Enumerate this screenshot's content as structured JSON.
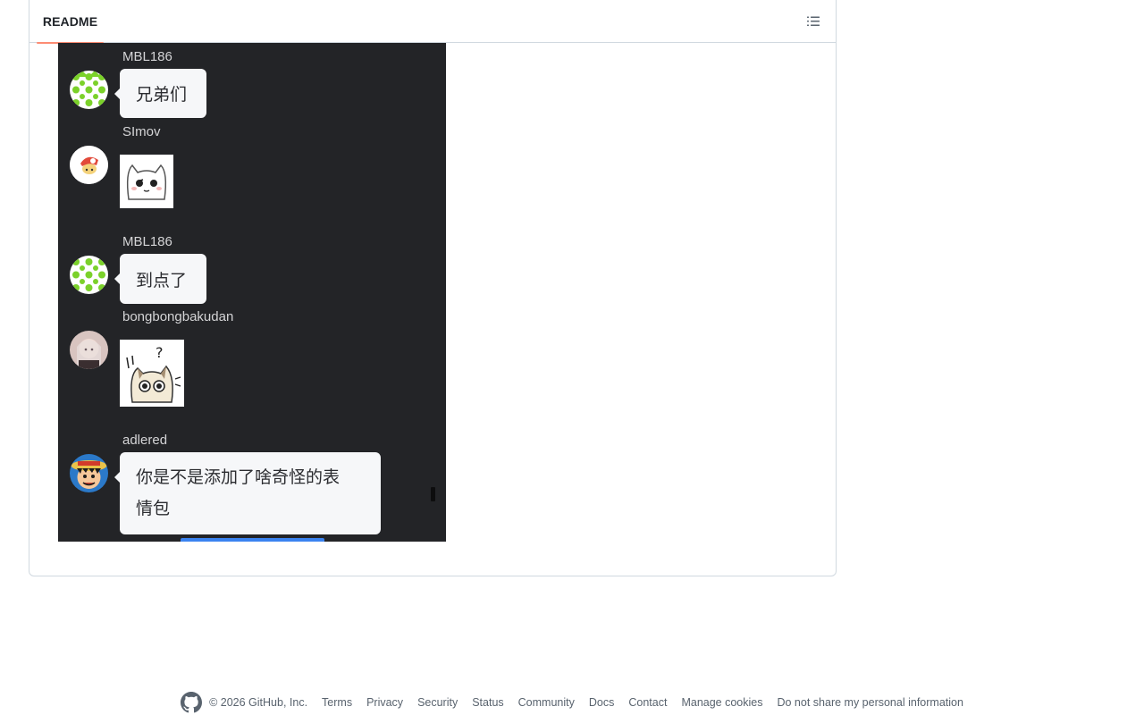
{
  "readme": {
    "tab_label": "README",
    "outline_icon": "list-unordered-icon"
  },
  "chat": {
    "messages": [
      {
        "name": "MBL186",
        "type": "text",
        "text": "兄弟们",
        "avatar": "green-pattern-avatar"
      },
      {
        "name": "SImov",
        "type": "sticker",
        "sticker": "white-cat-sticker",
        "avatar": "red-cap-character-avatar"
      },
      {
        "name": "MBL186",
        "type": "text",
        "text": "到点了",
        "avatar": "green-pattern-avatar"
      },
      {
        "name": "bongbongbakudan",
        "type": "sticker",
        "sticker": "confused-cat-sticker",
        "avatar": "anime-girl-avatar"
      },
      {
        "name": "adlered",
        "type": "text",
        "text_line1": "你是不是添加了啥奇怪的表",
        "text_line2": "情包",
        "avatar": "straw-hat-avatar"
      }
    ]
  },
  "footer": {
    "logo_icon": "github-mark-icon",
    "copyright": "© 2026 GitHub, Inc.",
    "links": [
      "Terms",
      "Privacy",
      "Security",
      "Status",
      "Community",
      "Docs",
      "Contact",
      "Manage cookies",
      "Do not share my personal information"
    ]
  },
  "colors": {
    "chat_background": "#232427",
    "bubble_background": "#f6f7f9",
    "tab_underline": "#fd8c73",
    "input_indicator": "#3b83f0"
  }
}
